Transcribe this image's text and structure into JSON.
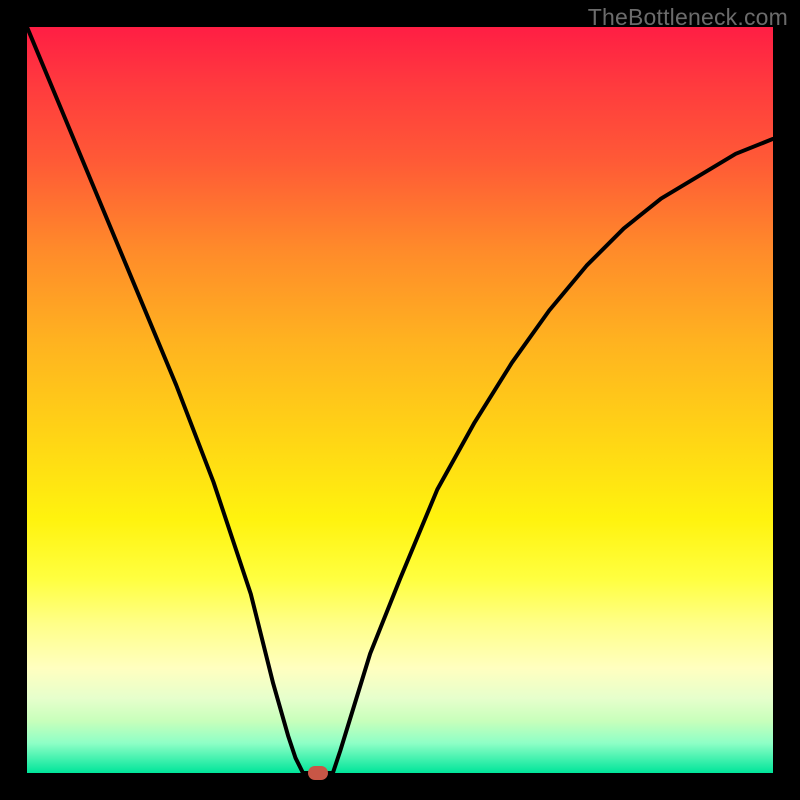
{
  "watermark": "TheBottleneck.com",
  "colors": {
    "frame": "#000000",
    "curve": "#000000",
    "marker": "#c85646",
    "gradient_top": "#ff1e44",
    "gradient_bottom": "#00e59a"
  },
  "chart_data": {
    "type": "line",
    "title": "",
    "xlabel": "",
    "ylabel": "",
    "xlim": [
      0,
      100
    ],
    "ylim": [
      0,
      100
    ],
    "grid": false,
    "legend": false,
    "series": [
      {
        "name": "bottleneck-curve",
        "x": [
          0,
          5,
          10,
          15,
          20,
          25,
          30,
          33,
          35,
          36,
          37,
          38,
          39,
          40,
          41,
          42,
          46,
          50,
          55,
          60,
          65,
          70,
          75,
          80,
          85,
          90,
          95,
          100
        ],
        "y": [
          100,
          88,
          76,
          64,
          52,
          39,
          24,
          12,
          5,
          2,
          0,
          0,
          0,
          0,
          0,
          3,
          16,
          26,
          38,
          47,
          55,
          62,
          68,
          73,
          77,
          80,
          83,
          85
        ]
      }
    ],
    "marker": {
      "x": 39,
      "y": 0
    },
    "gradient_stops": [
      {
        "pos": 0,
        "color": "#ff1e44"
      },
      {
        "pos": 18,
        "color": "#ff5a36"
      },
      {
        "pos": 42,
        "color": "#ffb220"
      },
      {
        "pos": 66,
        "color": "#fff30e"
      },
      {
        "pos": 86,
        "color": "#ffffc0"
      },
      {
        "pos": 100,
        "color": "#00e59a"
      }
    ]
  }
}
